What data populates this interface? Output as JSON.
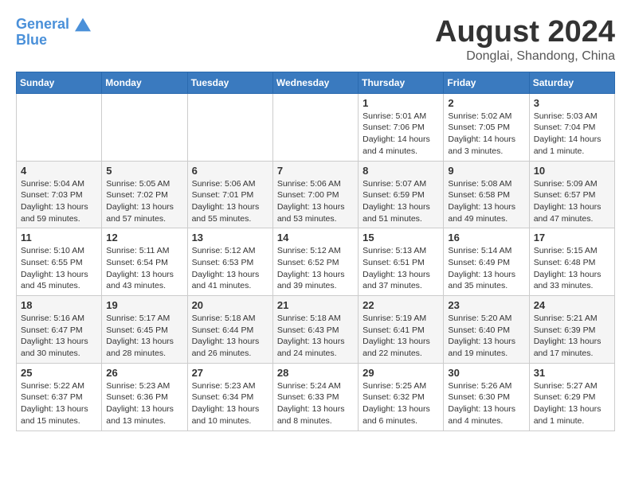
{
  "logo": {
    "line1": "General",
    "line2": "Blue"
  },
  "title": "August 2024",
  "subtitle": "Donglai, Shandong, China",
  "weekdays": [
    "Sunday",
    "Monday",
    "Tuesday",
    "Wednesday",
    "Thursday",
    "Friday",
    "Saturday"
  ],
  "weeks": [
    [
      {
        "day": "",
        "info": ""
      },
      {
        "day": "",
        "info": ""
      },
      {
        "day": "",
        "info": ""
      },
      {
        "day": "",
        "info": ""
      },
      {
        "day": "1",
        "info": "Sunrise: 5:01 AM\nSunset: 7:06 PM\nDaylight: 14 hours\nand 4 minutes."
      },
      {
        "day": "2",
        "info": "Sunrise: 5:02 AM\nSunset: 7:05 PM\nDaylight: 14 hours\nand 3 minutes."
      },
      {
        "day": "3",
        "info": "Sunrise: 5:03 AM\nSunset: 7:04 PM\nDaylight: 14 hours\nand 1 minute."
      }
    ],
    [
      {
        "day": "4",
        "info": "Sunrise: 5:04 AM\nSunset: 7:03 PM\nDaylight: 13 hours\nand 59 minutes."
      },
      {
        "day": "5",
        "info": "Sunrise: 5:05 AM\nSunset: 7:02 PM\nDaylight: 13 hours\nand 57 minutes."
      },
      {
        "day": "6",
        "info": "Sunrise: 5:06 AM\nSunset: 7:01 PM\nDaylight: 13 hours\nand 55 minutes."
      },
      {
        "day": "7",
        "info": "Sunrise: 5:06 AM\nSunset: 7:00 PM\nDaylight: 13 hours\nand 53 minutes."
      },
      {
        "day": "8",
        "info": "Sunrise: 5:07 AM\nSunset: 6:59 PM\nDaylight: 13 hours\nand 51 minutes."
      },
      {
        "day": "9",
        "info": "Sunrise: 5:08 AM\nSunset: 6:58 PM\nDaylight: 13 hours\nand 49 minutes."
      },
      {
        "day": "10",
        "info": "Sunrise: 5:09 AM\nSunset: 6:57 PM\nDaylight: 13 hours\nand 47 minutes."
      }
    ],
    [
      {
        "day": "11",
        "info": "Sunrise: 5:10 AM\nSunset: 6:55 PM\nDaylight: 13 hours\nand 45 minutes."
      },
      {
        "day": "12",
        "info": "Sunrise: 5:11 AM\nSunset: 6:54 PM\nDaylight: 13 hours\nand 43 minutes."
      },
      {
        "day": "13",
        "info": "Sunrise: 5:12 AM\nSunset: 6:53 PM\nDaylight: 13 hours\nand 41 minutes."
      },
      {
        "day": "14",
        "info": "Sunrise: 5:12 AM\nSunset: 6:52 PM\nDaylight: 13 hours\nand 39 minutes."
      },
      {
        "day": "15",
        "info": "Sunrise: 5:13 AM\nSunset: 6:51 PM\nDaylight: 13 hours\nand 37 minutes."
      },
      {
        "day": "16",
        "info": "Sunrise: 5:14 AM\nSunset: 6:49 PM\nDaylight: 13 hours\nand 35 minutes."
      },
      {
        "day": "17",
        "info": "Sunrise: 5:15 AM\nSunset: 6:48 PM\nDaylight: 13 hours\nand 33 minutes."
      }
    ],
    [
      {
        "day": "18",
        "info": "Sunrise: 5:16 AM\nSunset: 6:47 PM\nDaylight: 13 hours\nand 30 minutes."
      },
      {
        "day": "19",
        "info": "Sunrise: 5:17 AM\nSunset: 6:45 PM\nDaylight: 13 hours\nand 28 minutes."
      },
      {
        "day": "20",
        "info": "Sunrise: 5:18 AM\nSunset: 6:44 PM\nDaylight: 13 hours\nand 26 minutes."
      },
      {
        "day": "21",
        "info": "Sunrise: 5:18 AM\nSunset: 6:43 PM\nDaylight: 13 hours\nand 24 minutes."
      },
      {
        "day": "22",
        "info": "Sunrise: 5:19 AM\nSunset: 6:41 PM\nDaylight: 13 hours\nand 22 minutes."
      },
      {
        "day": "23",
        "info": "Sunrise: 5:20 AM\nSunset: 6:40 PM\nDaylight: 13 hours\nand 19 minutes."
      },
      {
        "day": "24",
        "info": "Sunrise: 5:21 AM\nSunset: 6:39 PM\nDaylight: 13 hours\nand 17 minutes."
      }
    ],
    [
      {
        "day": "25",
        "info": "Sunrise: 5:22 AM\nSunset: 6:37 PM\nDaylight: 13 hours\nand 15 minutes."
      },
      {
        "day": "26",
        "info": "Sunrise: 5:23 AM\nSunset: 6:36 PM\nDaylight: 13 hours\nand 13 minutes."
      },
      {
        "day": "27",
        "info": "Sunrise: 5:23 AM\nSunset: 6:34 PM\nDaylight: 13 hours\nand 10 minutes."
      },
      {
        "day": "28",
        "info": "Sunrise: 5:24 AM\nSunset: 6:33 PM\nDaylight: 13 hours\nand 8 minutes."
      },
      {
        "day": "29",
        "info": "Sunrise: 5:25 AM\nSunset: 6:32 PM\nDaylight: 13 hours\nand 6 minutes."
      },
      {
        "day": "30",
        "info": "Sunrise: 5:26 AM\nSunset: 6:30 PM\nDaylight: 13 hours\nand 4 minutes."
      },
      {
        "day": "31",
        "info": "Sunrise: 5:27 AM\nSunset: 6:29 PM\nDaylight: 13 hours\nand 1 minute."
      }
    ]
  ]
}
